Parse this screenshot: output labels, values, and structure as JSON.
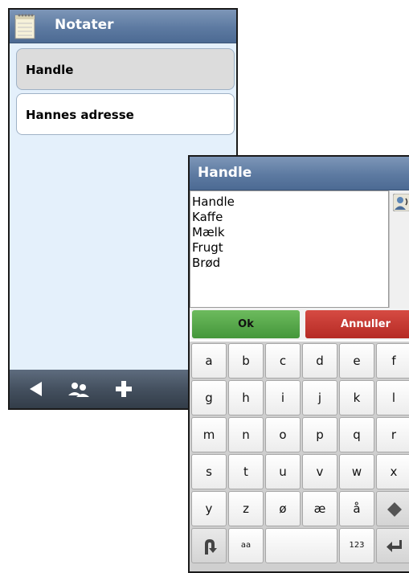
{
  "back_screen": {
    "title": "Notater",
    "notes": [
      {
        "label": "Handle",
        "selected": true
      },
      {
        "label": "Hannes adresse",
        "selected": false
      }
    ],
    "bottom_bar_icons": [
      "back-arrow-icon",
      "contacts-icon",
      "plus-icon"
    ]
  },
  "dialog": {
    "title": "Handle",
    "text": "Handle\nKaffe\nMælk\nFrugt\nBrød",
    "side_icon": "voice-contact-icon",
    "ok_label": "Ok",
    "cancel_label": "Annuller",
    "ok_color": "#4fa544",
    "cancel_color": "#c8352e"
  },
  "keyboard": {
    "rows": [
      [
        "a",
        "b",
        "c",
        "d",
        "e",
        "f"
      ],
      [
        "g",
        "h",
        "i",
        "j",
        "k",
        "l"
      ],
      [
        "m",
        "n",
        "o",
        "p",
        "q",
        "r"
      ],
      [
        "s",
        "t",
        "u",
        "v",
        "w",
        "x"
      ],
      [
        "y",
        "z",
        "ø",
        "æ",
        "å",
        ""
      ],
      [
        "",
        "aa",
        "",
        "",
        "123",
        ""
      ]
    ]
  },
  "colors": {
    "header_blue": "#5d7aa1",
    "list_background": "#e4f0fb",
    "bottom_bar": "#44505f"
  }
}
